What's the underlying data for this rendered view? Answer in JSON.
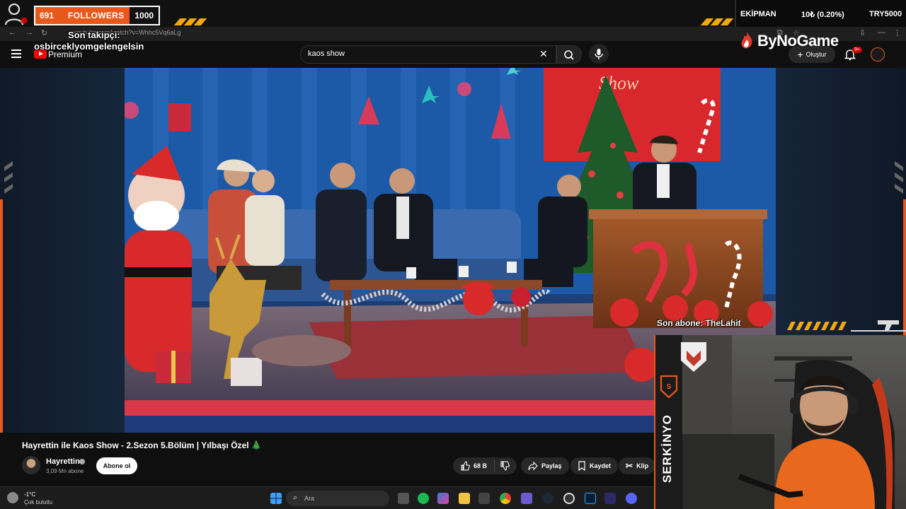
{
  "overlay": {
    "followers_count": "691",
    "followers_label": "FOLLOWERS",
    "followers_goal": "1000",
    "last_follower_label": "Son takipçi:",
    "last_follower_name": "osbirceklyomgelengelsin",
    "stat_left": "EKİPMAN",
    "stat_mid": "10₺ (0.20%)",
    "stat_right": "TRY5000",
    "sponsor": "ByNoGame",
    "last_sub_label": "Son abone: TheLahit",
    "streamer": "SERKİNYO",
    "accent": "#e8581a",
    "stripe_color": "#f2a80c"
  },
  "browser": {
    "url": "youtube.com/watch?v=Whhc5Vq6aLg"
  },
  "youtube": {
    "premium_label": "Premium",
    "search_value": "kaos show",
    "create_label": "Oluştur",
    "notif_count": "9+",
    "video_title": "Hayrettin ile Kaos Show - 2.Sezon 5.Bölüm | Yılbaşı Özel 🎄",
    "channel_name": "Hayrettin",
    "subscribers": "3,09 Mn abone",
    "subscribe_label": "Abone ol",
    "like_count": "68 B",
    "share_label": "Paylaş",
    "save_label": "Kaydet",
    "clip_label": "Klip"
  },
  "video_scene": {
    "sign_text": "Show"
  },
  "taskbar": {
    "temperature": "-1°C",
    "weather": "Çok bulutlu",
    "search_placeholder": "Ara",
    "icons": [
      "windows-start-icon",
      "file-icon",
      "spotify-icon",
      "copilot-icon",
      "folder-icon",
      "chrome-icon",
      "camera-icon",
      "steam-icon",
      "obs-icon",
      "photoshop-icon",
      "ps5000-icon",
      "display-icon",
      "discord-icon"
    ]
  }
}
